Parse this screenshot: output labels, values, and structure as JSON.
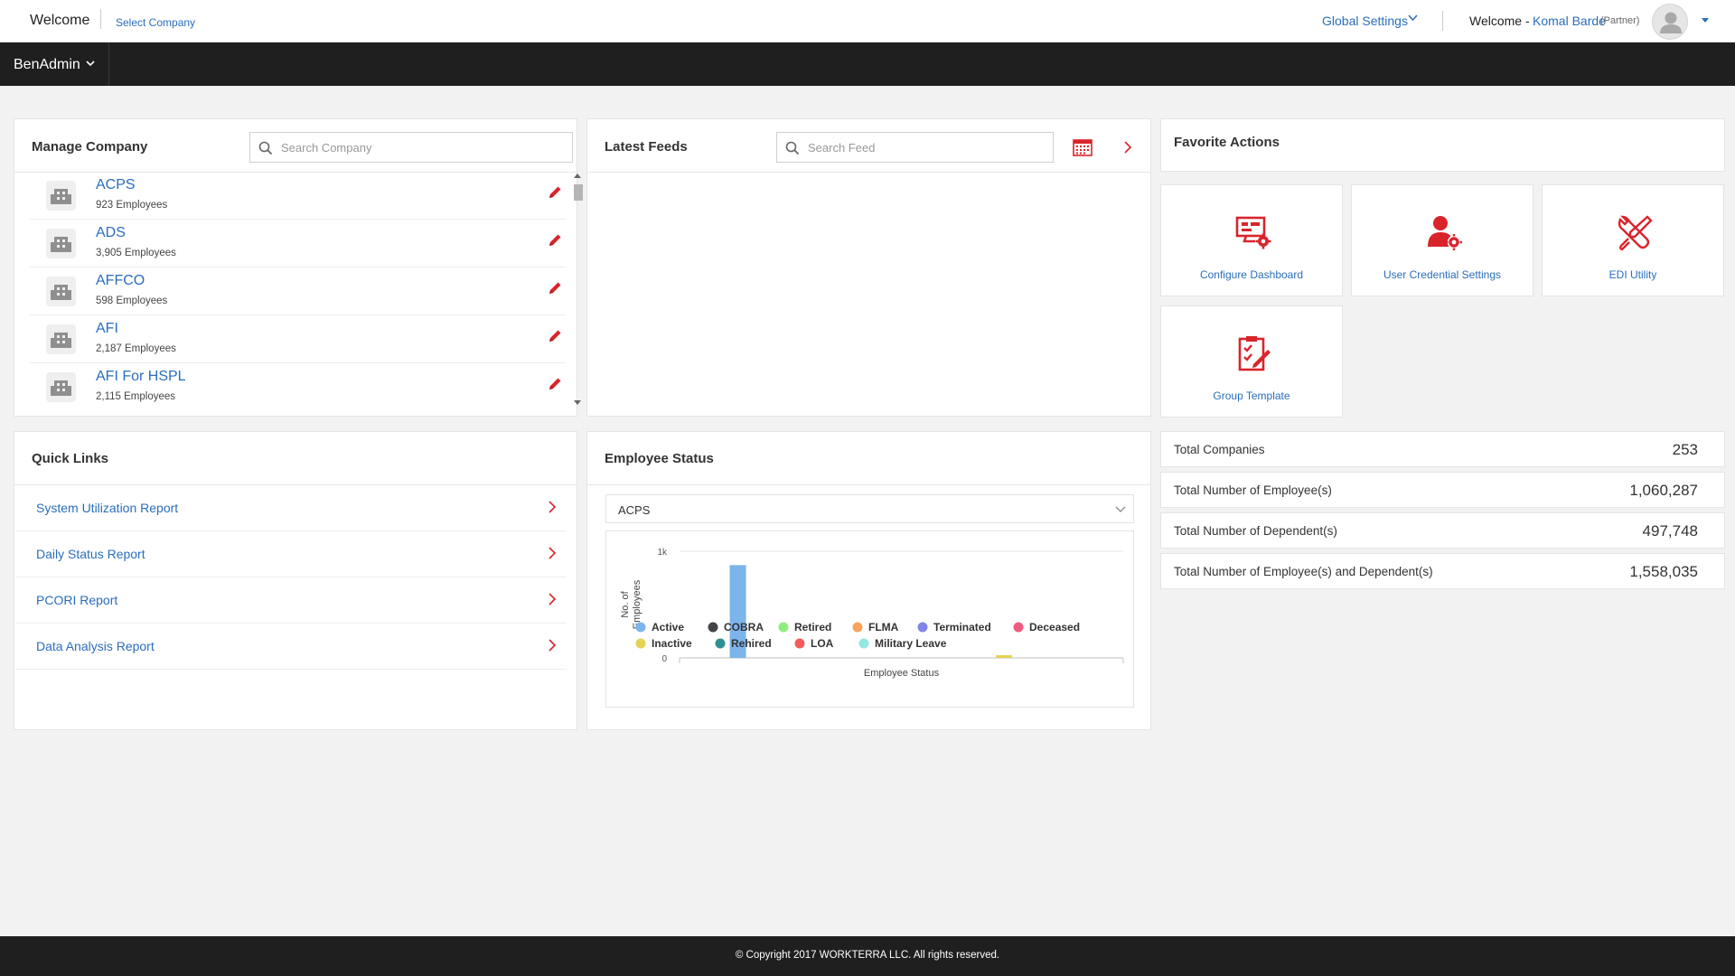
{
  "header": {
    "welcome": "Welcome",
    "select_company": "Select Company",
    "global_settings": "Global Settings",
    "welcome_user_prefix": "Welcome -",
    "user_name": "Komal Barde",
    "user_role": "(Partner)"
  },
  "nav": {
    "app_menu": "BenAdmin"
  },
  "manage_company": {
    "title": "Manage Company",
    "search_placeholder": "Search Company",
    "companies": [
      {
        "name": "ACPS",
        "employees": "923 Employees"
      },
      {
        "name": "ADS",
        "employees": "3,905 Employees"
      },
      {
        "name": "AFFCO",
        "employees": "598 Employees"
      },
      {
        "name": "AFI",
        "employees": "2,187 Employees"
      },
      {
        "name": "AFI For HSPL",
        "employees": "2,115 Employees"
      }
    ]
  },
  "latest_feeds": {
    "title": "Latest Feeds",
    "search_placeholder": "Search Feed"
  },
  "favorite_actions": {
    "title": "Favorite Actions",
    "tiles": [
      {
        "label": "Configure Dashboard",
        "icon": "configure-dashboard-icon"
      },
      {
        "label": "User Credential Settings",
        "icon": "user-credential-icon"
      },
      {
        "label": "EDI Utility",
        "icon": "edi-utility-icon"
      },
      {
        "label": "Group Template",
        "icon": "group-template-icon"
      }
    ]
  },
  "quick_links": {
    "title": "Quick Links",
    "items": [
      {
        "label": "System Utilization Report"
      },
      {
        "label": "Daily Status Report"
      },
      {
        "label": "PCORI Report"
      },
      {
        "label": "Data Analysis Report"
      }
    ]
  },
  "stats": [
    {
      "label": "Total Companies",
      "value": "253"
    },
    {
      "label": "Total Number of Employee(s)",
      "value": "1,060,287"
    },
    {
      "label": "Total Number of Dependent(s)",
      "value": "497,748"
    },
    {
      "label": "Total Number of Employee(s) and Dependent(s)",
      "value": "1,558,035"
    }
  ],
  "employee_status": {
    "title": "Employee Status",
    "selected_company": "ACPS"
  },
  "chart_data": {
    "type": "bar",
    "xlabel": "Employee Status",
    "ylabel": "No. of Employees",
    "ylim": [
      0,
      1000
    ],
    "y_ticks": [
      {
        "value": 0,
        "label": "0"
      },
      {
        "value": 1000,
        "label": "1k"
      }
    ],
    "grid": true,
    "legend_position": "bottom",
    "categories": [
      "Active",
      "COBRA",
      "Retired",
      "FLMA",
      "Terminated",
      "Deceased",
      "Inactive",
      "Rehired",
      "LOA",
      "Military Leave"
    ],
    "series": [
      {
        "name": "Active",
        "color": "#7cb5ec",
        "value": 870
      },
      {
        "name": "COBRA",
        "color": "#434348",
        "value": 0
      },
      {
        "name": "Retired",
        "color": "#90ed7d",
        "value": 0
      },
      {
        "name": "FLMA",
        "color": "#f7a35c",
        "value": 0
      },
      {
        "name": "Terminated",
        "color": "#8085e9",
        "value": 0
      },
      {
        "name": "Deceased",
        "color": "#f15c80",
        "value": 0
      },
      {
        "name": "Inactive",
        "color": "#e4d354",
        "value": 25
      },
      {
        "name": "Rehired",
        "color": "#2b908f",
        "value": 0
      },
      {
        "name": "LOA",
        "color": "#f45b5b",
        "value": 0
      },
      {
        "name": "Military Leave",
        "color": "#91e8e1",
        "value": 0
      }
    ]
  },
  "footer": {
    "copyright": "© Copyright 2017 WORKTERRA LLC. All rights reserved."
  },
  "colors": {
    "accent_red": "#d9242b",
    "link_blue": "#2a6ebb",
    "dark_bar": "#1f1f1f"
  }
}
